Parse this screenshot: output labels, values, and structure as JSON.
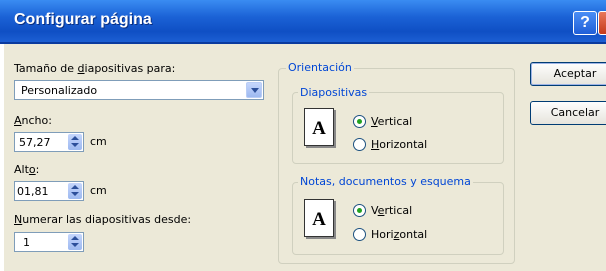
{
  "window": {
    "title": "Configurar página",
    "help_label": "?"
  },
  "slide_size": {
    "label_pre": "Tamaño de ",
    "label_key": "d",
    "label_post": "iapositivas para:",
    "value": "Personalizado"
  },
  "width": {
    "label_key": "A",
    "label_post": "ncho:",
    "value": "57,27",
    "unit": "cm"
  },
  "height": {
    "label_pre": "Alt",
    "label_key": "o",
    "label_post": ":",
    "value": "01,81",
    "unit": "cm"
  },
  "numbering": {
    "label_key": "N",
    "label_post": "umerar las diapositivas desde:",
    "value": "1"
  },
  "orientation": {
    "title": "Orientación",
    "slides": {
      "title": "Diapositivas",
      "icon_letter": "A",
      "vertical": {
        "key": "V",
        "rest": "ertical",
        "checked": true
      },
      "horizontal": {
        "key": "H",
        "rest": "orizontal",
        "checked": false
      }
    },
    "notes": {
      "title": "Notas, documentos y esquema",
      "icon_letter": "A",
      "vertical": {
        "pre": "V",
        "key": "e",
        "rest": "rtical",
        "checked": true
      },
      "horizontal": {
        "pre": "Hori",
        "key": "z",
        "rest": "ontal",
        "checked": false
      }
    }
  },
  "buttons": {
    "accept": "Aceptar",
    "cancel": "Cancelar"
  }
}
